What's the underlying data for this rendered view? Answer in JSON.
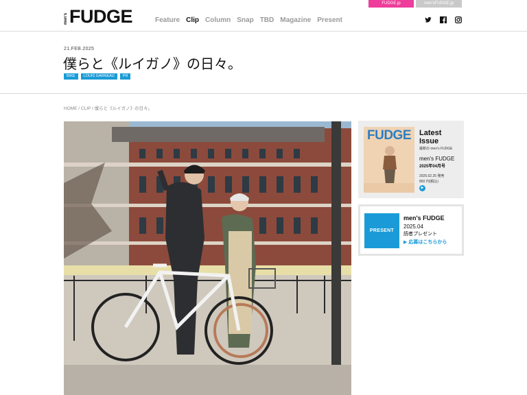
{
  "site_switch": {
    "fudge_label": "FUDGE.jp",
    "mensfudge_label": "men'sFUDGE.jp"
  },
  "logo": {
    "prefix": "men's",
    "name": "FUDGE"
  },
  "nav": {
    "items": [
      "Feature",
      "Clip",
      "Column",
      "Snap",
      "TBD",
      "Magazine",
      "Present"
    ],
    "active": "Clip"
  },
  "social": {
    "icons": [
      "twitter-icon",
      "facebook-icon",
      "instagram-icon"
    ]
  },
  "article": {
    "date": "21.FEB.2025",
    "title": "僕らと《ルイガノ》の日々。",
    "tags": [
      "BIKE",
      "LOUIS GARNEAU",
      "PR"
    ]
  },
  "breadcrumb": "HOME / CLIP / 僕らと《ルイガノ》の日々。",
  "latest_issue": {
    "cover_title": "FUDGE",
    "heading": "Latest Issue",
    "subheading": "最新の men's FUDGE",
    "magazine": "men's FUDGE",
    "issue": "2025年04月号",
    "release": "2025.02.25 発売",
    "price": "850 円(税込)"
  },
  "present": {
    "box_label": "PRESENT",
    "magazine": "men's FUDGE",
    "issue": "2025.04",
    "description": "読者プレゼント",
    "link": "▶ 応募はこちらから"
  },
  "colors": {
    "accent": "#1a9bd7",
    "fudge_pink": "#ee3d9a",
    "nav_inactive": "#9a9a9a"
  }
}
